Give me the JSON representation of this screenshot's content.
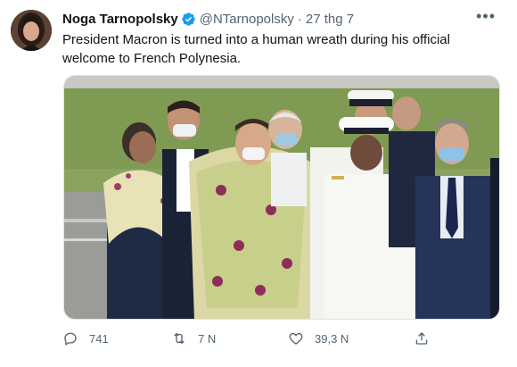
{
  "tweet": {
    "author": {
      "display_name": "Noga Tarnopolsky",
      "handle": "@NTarnopolsky",
      "verified": true,
      "verified_icon": "verified-badge-icon"
    },
    "separator": "·",
    "timestamp": "27 thg 7",
    "more_icon": "more-horizontal-icon",
    "more_label": "•••",
    "text": "President Macron is turned into a human wreath during his official welcome to French Polynesia.",
    "media": {
      "kind": "photo"
    },
    "actions": {
      "reply": {
        "icon": "reply-icon",
        "count": "741"
      },
      "retweet": {
        "icon": "retweet-icon",
        "count": "7 N"
      },
      "like": {
        "icon": "heart-icon",
        "count": "39,3 N"
      },
      "share": {
        "icon": "share-icon",
        "count": ""
      }
    }
  },
  "colors": {
    "text_primary": "#0f1419",
    "text_secondary": "#536471",
    "verified_blue": "#1d9bf0",
    "border": "#dfe3e6"
  }
}
